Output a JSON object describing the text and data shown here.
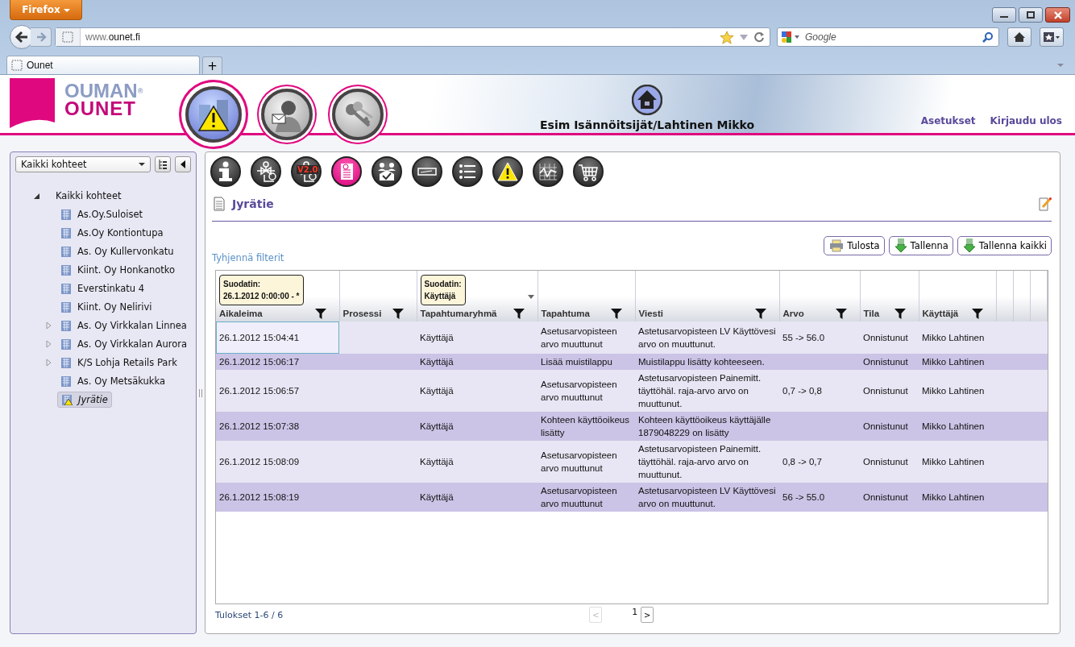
{
  "browser": {
    "menu_button": "Firefox",
    "url_prefix": "www.",
    "url_domain": "ounet.fi",
    "search_placeholder": "Google",
    "tab": "Ounet",
    "new_tab": "+"
  },
  "header": {
    "logo_top": "OUMAN",
    "logo_mark": "®",
    "logo_bottom": "OUNET",
    "nav": [
      {
        "kind": "alarm",
        "selected": true
      },
      {
        "kind": "messages",
        "selected": false
      },
      {
        "kind": "keys",
        "selected": false
      }
    ],
    "user": "Esim Isännöitsijät/Lahtinen Mikko",
    "links": [
      "Asetukset",
      "Kirjaudu ulos"
    ]
  },
  "sidebar": {
    "dropdown": "Kaikki kohteet",
    "tree": [
      {
        "label": "Kaikki kohteet",
        "expanded": true,
        "children": [
          {
            "label": "As.Oy.Suloiset",
            "collapsed": false,
            "alarm": false,
            "selected": false
          },
          {
            "label": "As.Oy Kontiontupa",
            "collapsed": false,
            "alarm": false,
            "selected": false
          },
          {
            "label": "As. Oy Kullervonkatu",
            "collapsed": false,
            "alarm": false,
            "selected": false
          },
          {
            "label": "Kiint. Oy Honkanotko",
            "collapsed": false,
            "alarm": false,
            "selected": false
          },
          {
            "label": "Everstinkatu 4",
            "collapsed": false,
            "alarm": false,
            "selected": false
          },
          {
            "label": "Kiint. Oy Nelirivi",
            "collapsed": false,
            "alarm": false,
            "selected": false
          },
          {
            "label": "As. Oy Virkkalan Linnea",
            "collapsed": true,
            "alarm": false,
            "selected": false
          },
          {
            "label": "As. Oy Virkkalan Aurora",
            "collapsed": true,
            "alarm": false,
            "selected": false
          },
          {
            "label": "K/S Lohja Retails Park",
            "collapsed": true,
            "alarm": false,
            "selected": false
          },
          {
            "label": "As. Oy Metsäkukka",
            "collapsed": false,
            "alarm": false,
            "selected": false
          },
          {
            "label": "Jyrätie",
            "collapsed": false,
            "alarm": true,
            "selected": true
          }
        ]
      }
    ]
  },
  "toolbar": [
    {
      "kind": "info",
      "selected": false
    },
    {
      "kind": "valve",
      "selected": false
    },
    {
      "kind": "valve",
      "selected": false,
      "badge": "V2.0"
    },
    {
      "kind": "report",
      "selected": true
    },
    {
      "kind": "users",
      "selected": false
    },
    {
      "kind": "device",
      "selected": false
    },
    {
      "kind": "list",
      "selected": false
    },
    {
      "kind": "warning",
      "selected": false
    },
    {
      "kind": "chart",
      "selected": false
    },
    {
      "kind": "cart",
      "selected": false
    }
  ],
  "page": {
    "title": "Jyrätie",
    "clear_filters": "Tyhjennä filterit",
    "buttons": [
      {
        "kind": "print",
        "label": "Tulosta"
      },
      {
        "kind": "save",
        "label": "Tallenna"
      },
      {
        "kind": "save",
        "label": "Tallenna kaikki"
      }
    ]
  },
  "table": {
    "columns": [
      {
        "label": "Aikaleima",
        "filter_title": "Suodatin:",
        "filter_value": "26.1.2012 0:00:00 - *",
        "filter_dropdown": false
      },
      {
        "label": "Prosessi"
      },
      {
        "label": "Tapahtumaryhmä",
        "filter_title": "Suodatin:",
        "filter_value": "Käyttäjä",
        "filter_dropdown": true
      },
      {
        "label": "Tapahtuma"
      },
      {
        "label": "Viesti"
      },
      {
        "label": "Arvo"
      },
      {
        "label": "Tila"
      },
      {
        "label": "Käyttäjä"
      }
    ],
    "rows": [
      {
        "focused": true,
        "cells": [
          "26.1.2012 15:04:41",
          "",
          "Käyttäjä",
          "Asetusarvopisteen arvo muuttunut",
          "Astetusarvopisteen LV Käyttövesi arvo on muuttunut.",
          "55 -> 56.0",
          "Onnistunut",
          "Mikko Lahtinen"
        ]
      },
      {
        "focused": false,
        "cells": [
          "26.1.2012 15:06:17",
          "",
          "Käyttäjä",
          "Lisää muistilappu",
          "Muistilappu lisätty kohteeseen.",
          "",
          "Onnistunut",
          "Mikko Lahtinen"
        ]
      },
      {
        "focused": false,
        "cells": [
          "26.1.2012 15:06:57",
          "",
          "Käyttäjä",
          "Asetusarvopisteen arvo muuttunut",
          "Astetusarvopisteen Painemitt. täyttöhäl. raja-arvo arvo on muuttunut.",
          "0,7 -> 0,8",
          "Onnistunut",
          "Mikko Lahtinen"
        ]
      },
      {
        "focused": false,
        "cells": [
          "26.1.2012 15:07:38",
          "",
          "Käyttäjä",
          "Kohteen käyttöoikeus lisätty",
          "Kohteen käyttöoikeus käyttäjälle 1879048229 on lisätty",
          "",
          "Onnistunut",
          "Mikko Lahtinen"
        ]
      },
      {
        "focused": false,
        "cells": [
          "26.1.2012 15:08:09",
          "",
          "Käyttäjä",
          "Asetusarvopisteen arvo muuttunut",
          "Astetusarvopisteen Painemitt. täyttöhäl. raja-arvo arvo on muuttunut.",
          "0,8 -> 0,7",
          "Onnistunut",
          "Mikko Lahtinen"
        ]
      },
      {
        "focused": false,
        "cells": [
          "26.1.2012 15:08:19",
          "",
          "Käyttäjä",
          "Asetusarvopisteen arvo muuttunut",
          "Astetusarvopisteen LV Käyttövesi arvo on muuttunut.",
          "56 -> 55.0",
          "Onnistunut",
          "Mikko Lahtinen"
        ]
      }
    ]
  },
  "footer": {
    "results": "Tulokset 1-6 / 6",
    "prev": "<",
    "page": "1",
    "next": ">",
    "prev_disabled": true
  }
}
